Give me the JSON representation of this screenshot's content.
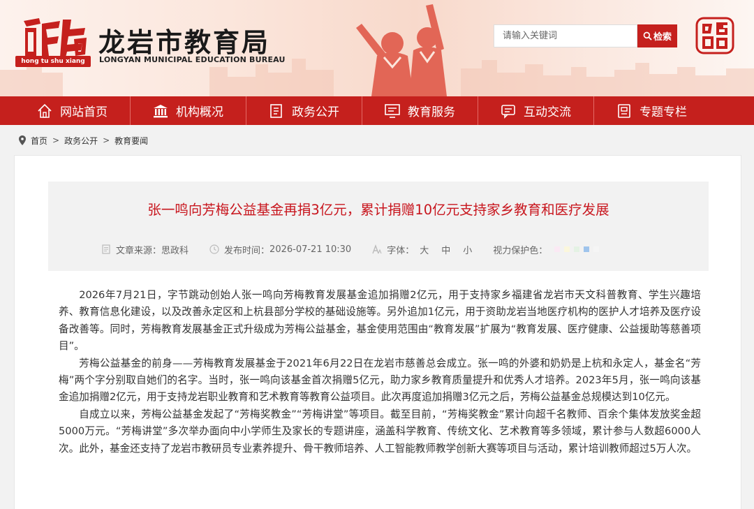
{
  "header": {
    "site_title": "龙岩市教育局",
    "site_subtitle": "LONGYAN MUNICIPAL EDUCATION BUREAU",
    "logo_caption": "hong tu shu xiang",
    "logo_icon": "hongtu-shuxiang-logo",
    "seal_icon": "longyan-china-seal",
    "search": {
      "placeholder": "请输入关键词",
      "button_label": "检索"
    }
  },
  "nav": {
    "items": [
      {
        "label": "网站首页",
        "icon": "home-icon"
      },
      {
        "label": "机构概况",
        "icon": "institution-icon"
      },
      {
        "label": "政务公开",
        "icon": "document-icon"
      },
      {
        "label": "教育服务",
        "icon": "monitor-icon"
      },
      {
        "label": "互动交流",
        "icon": "chat-icon"
      },
      {
        "label": "专题专栏",
        "icon": "book-icon"
      }
    ]
  },
  "breadcrumb": [
    "首页",
    "政务公开",
    "教育要闻"
  ],
  "article": {
    "title": "张一鸣向芳梅公益基金再捐3亿元，累计捐赠10亿元支持家乡教育和医疗发展",
    "meta": {
      "source_label": "文章来源：",
      "source": "思政科",
      "time_label": "发布时间：",
      "time": "2026-07-21 10:30",
      "font_label": "字体：",
      "font_sizes": [
        "大",
        "中",
        "小"
      ],
      "eye_label": "视力保护色：",
      "eye_colors": [
        "#fbe9f4",
        "#fbf7dc",
        "#e4f2e4",
        "#9fc4ec",
        "#f5f5f5"
      ]
    },
    "paragraphs": [
      "2026年7月21日，字节跳动创始人张一鸣向芳梅教育发展基金追加捐赠2亿元，用于支持家乡福建省龙岩市天文科普教育、学生兴趣培养、教育信息化建设，以及改善永定区和上杭县部分学校的基础设施等。另外追加1亿元，用于资助龙岩当地医疗机构的医护人才培养及医疗设备改善等。同时，芳梅教育发展基金正式升级成为芳梅公益基金，基金使用范围由“教育发展”扩展为“教育发展、医疗健康、公益援助等慈善项目”。",
      "芳梅公益基金的前身——芳梅教育发展基金于2021年6月22日在龙岩市慈善总会成立。张一鸣的外婆和奶奶是上杭和永定人，基金名“芳梅”两个字分别取自她们的名字。当时，张一鸣向该基金首次捐赠5亿元，助力家乡教育质量提升和优秀人才培养。2023年5月，张一鸣向该基金追加捐赠2亿元，用于支持龙岩职业教育和艺术教育等教育公益项目。此次再度追加捐赠3亿元之后，芳梅公益基金总规模达到10亿元。",
      "自成立以来，芳梅公益基金发起了“芳梅奖教金”“芳梅讲堂”等项目。截至目前，“芳梅奖教金”累计向超千名教师、百余个集体发放奖金超5000万元。“芳梅讲堂”多次举办面向中小学师生及家长的专题讲座，涵盖科学教育、传统文化、艺术教育等多领域，累计参与人数超6000人次。此外，基金还支持了龙岩市教研员专业素养提升、骨干教师培养、人工智能教师教学创新大赛等项目与活动，累计培训教师超过5万人次。"
    ]
  },
  "colors": {
    "brand_red": "#c5201d",
    "title_red": "#c8161e",
    "page_bg": "#f2f2f2"
  }
}
